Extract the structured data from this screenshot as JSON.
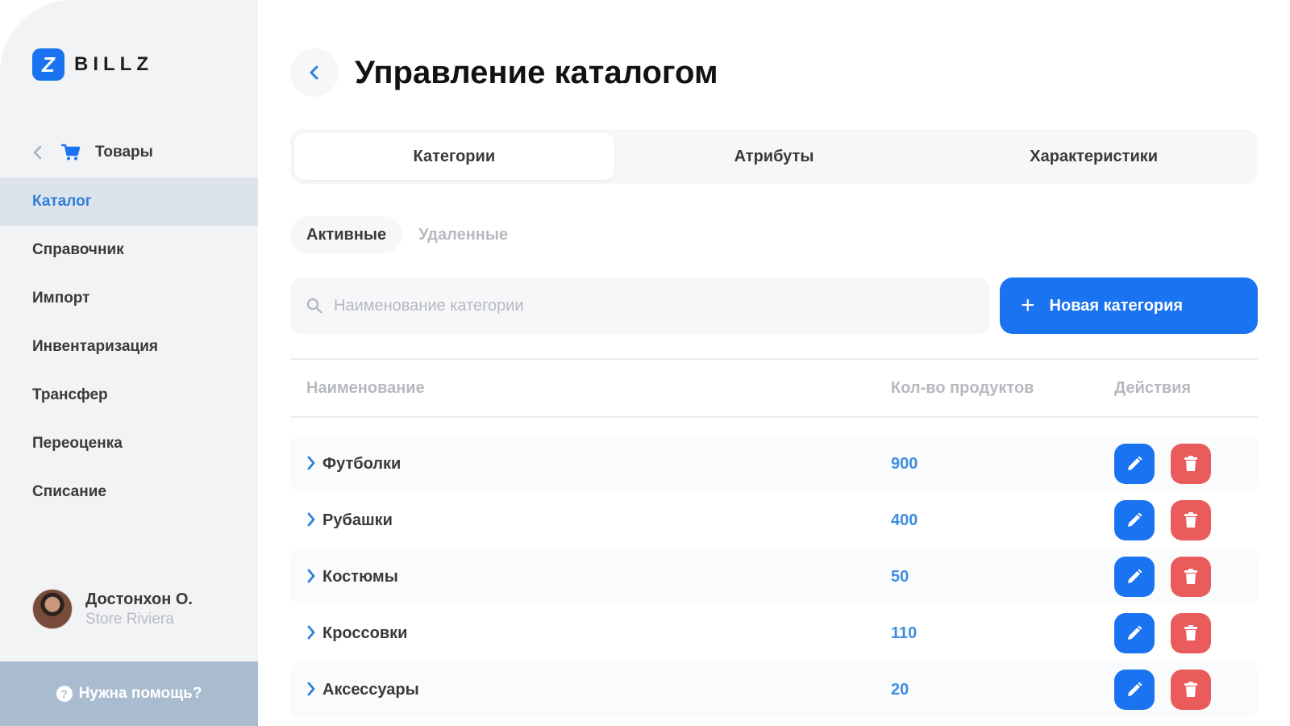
{
  "sidebar": {
    "logo_letter": "Z",
    "logo_text": "BILLZ",
    "parent_label": "Товары",
    "items": [
      {
        "label": "Каталог",
        "active": true
      },
      {
        "label": "Справочник"
      },
      {
        "label": "Импорт"
      },
      {
        "label": "Инвентаризация"
      },
      {
        "label": "Трансфер"
      },
      {
        "label": "Переоценка"
      },
      {
        "label": "Списание"
      }
    ],
    "profile": {
      "name": "Достонхон О.",
      "store": "Store Riviera"
    },
    "help_label": "Нужна помощь?"
  },
  "header": {
    "title": "Управление каталогом"
  },
  "tabs": [
    "Категории",
    "Атрибуты",
    "Характеристики"
  ],
  "status_tabs": [
    "Активные",
    "Удаленные"
  ],
  "search": {
    "placeholder": "Наименование категории",
    "value": ""
  },
  "new_button": {
    "label": "Новая категория"
  },
  "table": {
    "columns": [
      "Наименование",
      "Кол-во продуктов",
      "Действия"
    ],
    "rows": [
      {
        "name": "Футболки",
        "count": "900"
      },
      {
        "name": "Рубашки",
        "count": "400"
      },
      {
        "name": "Костюмы",
        "count": "50"
      },
      {
        "name": "Кроссовки",
        "count": "110"
      },
      {
        "name": "Аксессуары",
        "count": "20"
      }
    ]
  },
  "colors": {
    "accent": "#1a73f0",
    "danger": "#ea5b5b",
    "active_nav_bg": "#dde3ea",
    "active_nav_text": "#2e7fd8",
    "count_text": "#3f8de0"
  },
  "icons": [
    "back-chevron-icon",
    "cart-icon",
    "search-icon",
    "plus-icon",
    "chevron-right-icon",
    "pencil-icon",
    "trash-icon",
    "help-icon"
  ]
}
